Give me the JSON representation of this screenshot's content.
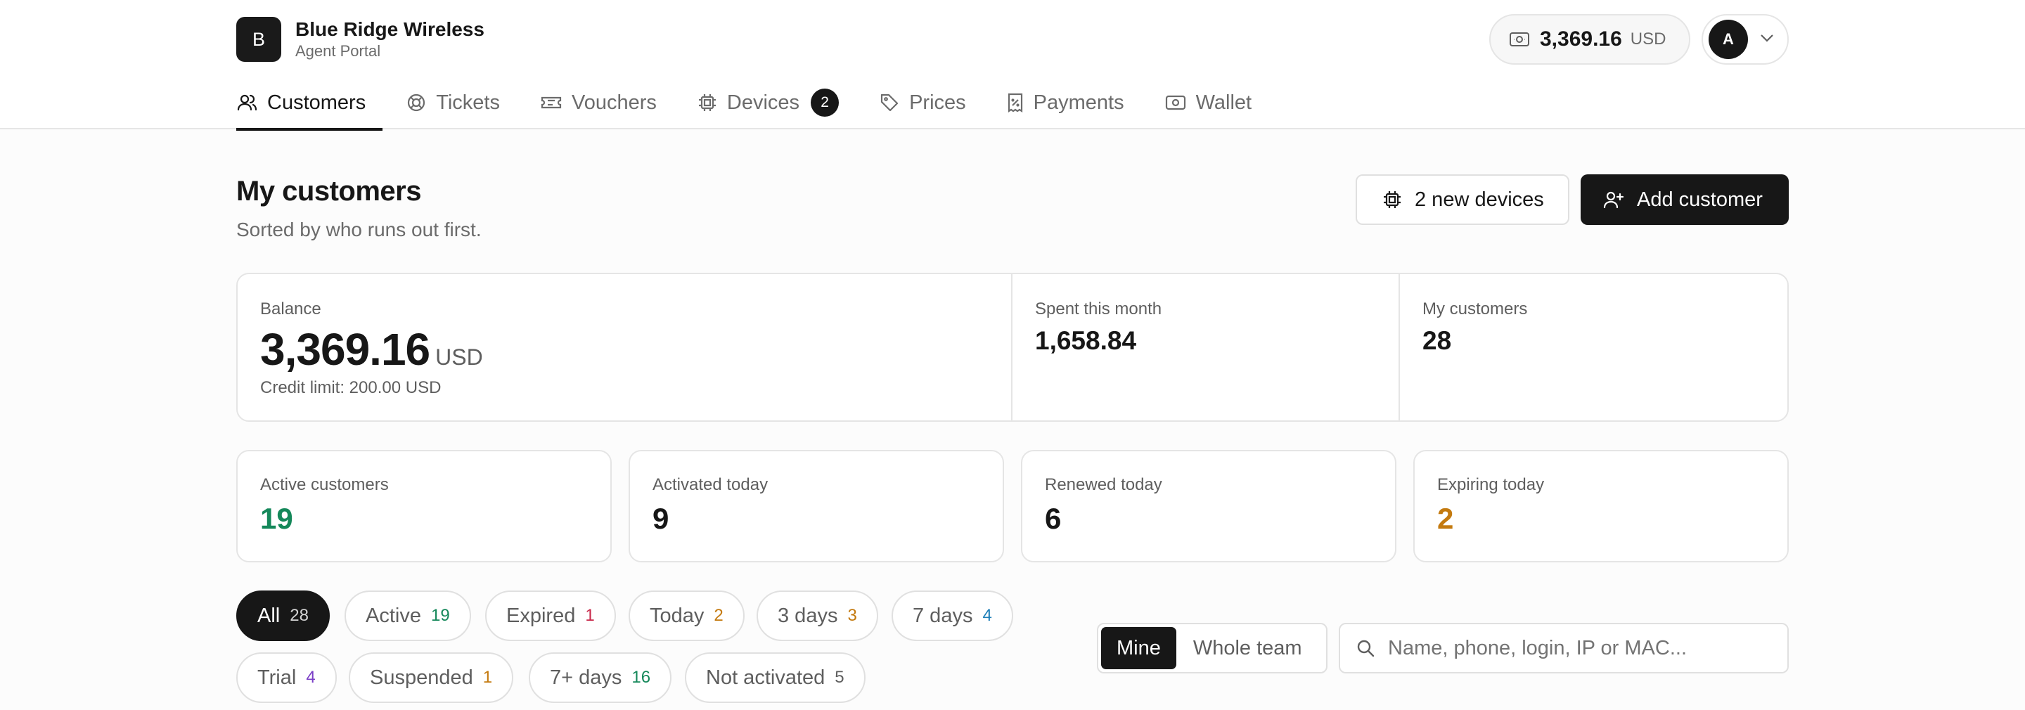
{
  "brand": {
    "logo_letter": "B",
    "name": "Blue Ridge Wireless",
    "subtitle": "Agent Portal"
  },
  "header": {
    "balance_amount": "3,369.16",
    "balance_currency": "USD",
    "user_initial": "A"
  },
  "tabs": [
    {
      "label": "Customers",
      "icon": "users-icon",
      "active": true
    },
    {
      "label": "Tickets",
      "icon": "lifebuoy-icon"
    },
    {
      "label": "Vouchers",
      "icon": "ticket-icon"
    },
    {
      "label": "Devices",
      "icon": "chip-icon",
      "badge": "2"
    },
    {
      "label": "Prices",
      "icon": "tag-icon"
    },
    {
      "label": "Payments",
      "icon": "receipt-icon"
    },
    {
      "label": "Wallet",
      "icon": "banknote-icon"
    }
  ],
  "page": {
    "title": "My customers",
    "subtitle": "Sorted by who runs out first."
  },
  "actions": {
    "new_devices_label": "2 new devices",
    "add_customer_label": "Add customer"
  },
  "summary": {
    "balance_label": "Balance",
    "balance_value": "3,369.16",
    "balance_unit": "USD",
    "credit_limit": "Credit limit: 200.00 USD",
    "spent_label": "Spent this month",
    "spent_value": "1,658.84",
    "customers_label": "My customers",
    "customers_value": "28"
  },
  "kpis": [
    {
      "label": "Active customers",
      "value": "19",
      "color": "#15885a"
    },
    {
      "label": "Activated today",
      "value": "9",
      "color": "#171717"
    },
    {
      "label": "Renewed today",
      "value": "6",
      "color": "#171717"
    },
    {
      "label": "Expiring today",
      "value": "2",
      "color": "#c47a0f"
    }
  ],
  "filters": [
    {
      "label": "All",
      "count": "28",
      "color": "#d4d4d4",
      "selected": true
    },
    {
      "label": "Active",
      "count": "19",
      "color": "#15885a"
    },
    {
      "label": "Expired",
      "count": "1",
      "color": "#c8284a"
    },
    {
      "label": "Today",
      "count": "2",
      "color": "#c47a0f"
    },
    {
      "label": "3 days",
      "count": "3",
      "color": "#c47a0f"
    },
    {
      "label": "7 days",
      "count": "4",
      "color": "#1e7fb8"
    },
    {
      "label": "Trial",
      "count": "4",
      "color": "#7b3fc7"
    },
    {
      "label": "Suspended",
      "count": "1",
      "color": "#c47a0f"
    },
    {
      "label": "7+ days",
      "count": "16",
      "color": "#15885a"
    },
    {
      "label": "Not activated",
      "count": "5",
      "color": "#5e5e5e"
    }
  ],
  "scope": {
    "mine_label": "Mine",
    "team_label": "Whole team"
  },
  "search": {
    "placeholder": "Name, phone, login, IP or MAC..."
  }
}
